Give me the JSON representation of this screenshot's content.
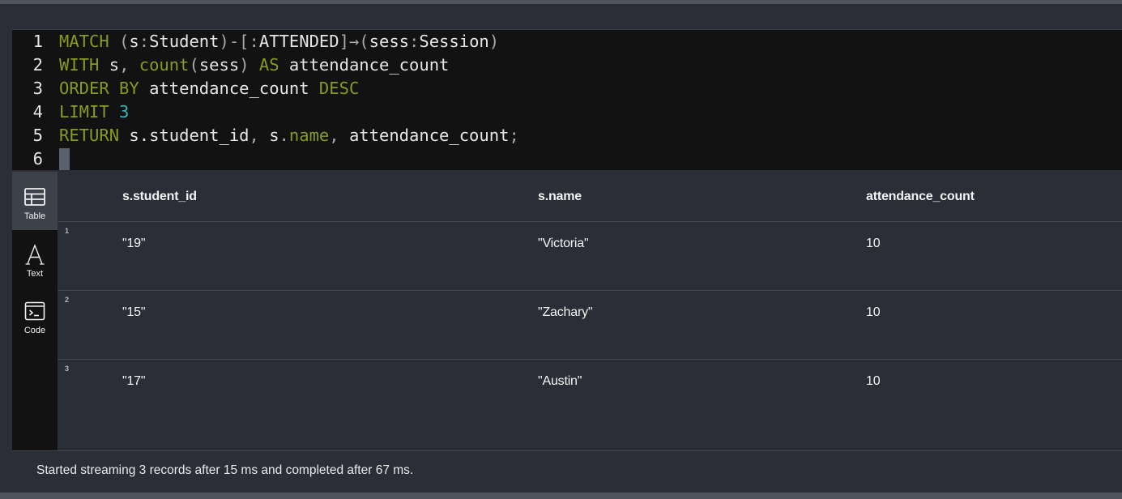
{
  "editor": {
    "lines": [
      {
        "num": "1"
      },
      {
        "num": "2"
      },
      {
        "num": "3"
      },
      {
        "num": "4"
      },
      {
        "num": "5"
      },
      {
        "num": "6"
      }
    ],
    "tokens": {
      "l1_match": "MATCH",
      "l1_open": "(",
      "l1_s": "s",
      "l1_colon1": ":",
      "l1_student": "Student",
      "l1_close1": ")",
      "l1_dash_br": "-[",
      "l1_colon2": ":",
      "l1_attended": "ATTENDED",
      "l1_br_arrow": "]→(",
      "l1_sess": "sess",
      "l1_colon3": ":",
      "l1_session": "Session",
      "l1_close2": ")",
      "l2_with": "WITH",
      "l2_s": " s",
      "l2_comma": ",",
      "l2_count": " count",
      "l2_paren_open": "(",
      "l2_sess": "sess",
      "l2_paren_close": ")",
      "l2_as": " AS",
      "l2_alias": " attendance_count",
      "l3_orderby": "ORDER BY",
      "l3_alias": " attendance_count",
      "l3_desc": " DESC",
      "l4_limit": "LIMIT",
      "l4_num": " 3",
      "l5_return": "RETURN",
      "l5_sid": " s.student_id",
      "l5_comma1": ",",
      "l5_s": " s",
      "l5_dot": ".",
      "l5_name": "name",
      "l5_comma2": ",",
      "l5_alias": " attendance_count",
      "l5_semi": ";"
    }
  },
  "sidebar": {
    "items": [
      {
        "label": "Table",
        "icon": "table-icon"
      },
      {
        "label": "Text",
        "icon": "text-icon"
      },
      {
        "label": "Code",
        "icon": "code-icon"
      }
    ]
  },
  "table": {
    "columns": [
      "s.student_id",
      "s.name",
      "attendance_count"
    ],
    "rows": [
      {
        "index": "1",
        "cells": [
          "\"19\"",
          "\"Victoria\"",
          "10"
        ]
      },
      {
        "index": "2",
        "cells": [
          "\"15\"",
          "\"Zachary\"",
          "10"
        ]
      },
      {
        "index": "3",
        "cells": [
          "\"17\"",
          "\"Austin\"",
          "10"
        ]
      }
    ]
  },
  "status": {
    "text": "Started streaming 3 records after 15 ms and completed after 67 ms."
  },
  "colors": {
    "keyword": "#8a9a1f",
    "number": "#34b7b7",
    "editor_bg": "#121212",
    "panel_bg": "#2b2e36"
  }
}
